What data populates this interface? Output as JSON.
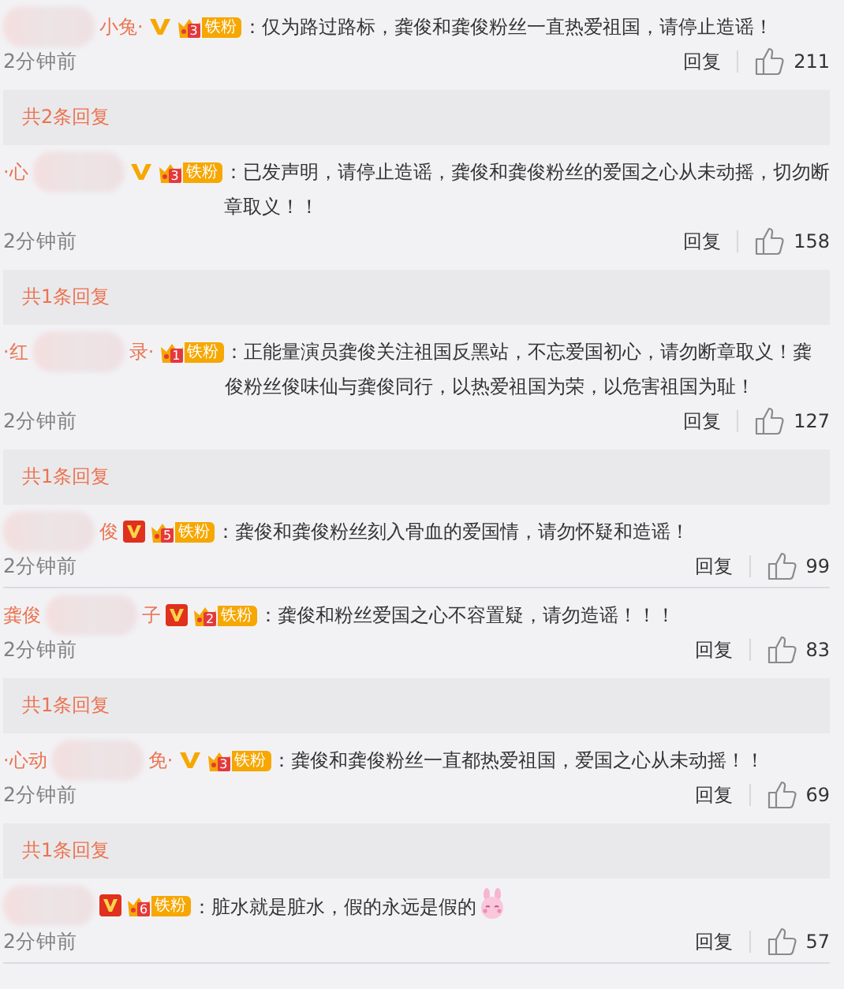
{
  "comments": [
    {
      "name_end": "小兔·",
      "verified": {
        "kind": "gold"
      },
      "fan_level": "3",
      "fan_label": "铁粉",
      "text": "：仅为路过路标，龚俊和龚俊粉丝一直热爱祖国，请停止造谣！",
      "time": "2分钟前",
      "reply": "回复",
      "likes": "211",
      "replies": "共2条回复"
    },
    {
      "name_start": "·心",
      "verified": {
        "kind": "gold"
      },
      "fan_level": "3",
      "fan_label": "铁粉",
      "text": "：已发声明，请停止造谣，龚俊和龚俊粉丝的爱国之心从未动摇，切勿断章取义！！",
      "time": "2分钟前",
      "reply": "回复",
      "likes": "158",
      "replies": "共1条回复"
    },
    {
      "name_start": "·红",
      "name_end": "录·",
      "fan_level": "1",
      "fan_label": "铁粉",
      "text": "：正能量演员龚俊关注祖国反黑站，不忘爱国初心，请勿断章取义！龚俊粉丝俊味仙与龚俊同行，以热爱祖国为荣，以危害祖国为耻！",
      "time": "2分钟前",
      "reply": "回复",
      "likes": "127",
      "replies": "共1条回复"
    },
    {
      "name_end": "俊",
      "verified": {
        "kind": "red"
      },
      "fan_level": "5",
      "fan_label": "铁粉",
      "text": "：龚俊和龚俊粉丝刻入骨血的爱国情，请勿怀疑和造谣！",
      "time": "2分钟前",
      "reply": "回复",
      "likes": "99"
    },
    {
      "name_start": "龚俊",
      "name_end": "子",
      "verified": {
        "kind": "red"
      },
      "fan_level": "2",
      "fan_label": "铁粉",
      "text": "：龚俊和粉丝爱国之心不容置疑，请勿造谣！！！",
      "time": "2分钟前",
      "reply": "回复",
      "likes": "83",
      "replies": "共1条回复"
    },
    {
      "name_start": "·心动",
      "name_end": "免·",
      "verified": {
        "kind": "gold"
      },
      "fan_level": "3",
      "fan_label": "铁粉",
      "text": "：龚俊和龚俊粉丝一直都热爱祖国，爱国之心从未动摇！！",
      "time": "2分钟前",
      "reply": "回复",
      "likes": "69",
      "replies": "共1条回复"
    },
    {
      "verified": {
        "kind": "red"
      },
      "fan_level": "6",
      "fan_label": "铁粉",
      "text": "：脏水就是脏水，假的永远是假的",
      "emoji": {
        "kind": "rabbit"
      },
      "time": "2分钟前",
      "reply": "回复",
      "likes": "57"
    }
  ]
}
